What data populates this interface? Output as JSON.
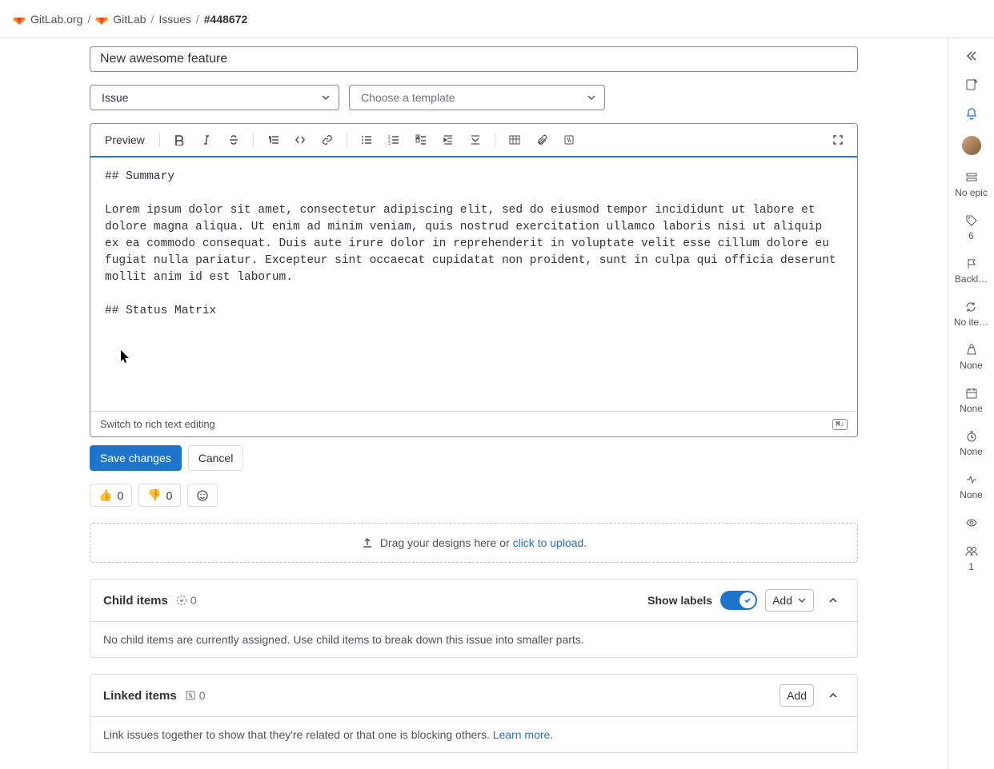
{
  "breadcrumb": {
    "org": "GitLab.org",
    "project": "GitLab",
    "section": "Issues",
    "id": "#448672"
  },
  "title_input": {
    "value": "New awesome feature"
  },
  "type_select": {
    "value": "Issue"
  },
  "template_select": {
    "placeholder": "Choose a template"
  },
  "editor": {
    "preview": "Preview",
    "content": "## Summary\n\nLorem ipsum dolor sit amet, consectetur adipiscing elit, sed do eiusmod tempor incididunt ut labore et dolore magna aliqua. Ut enim ad minim veniam, quis nostrud exercitation ullamco laboris nisi ut aliquip ex ea commodo consequat. Duis aute irure dolor in reprehenderit in voluptate velit esse cillum dolore eu fugiat nulla pariatur. Excepteur sint occaecat cupidatat non proident, sunt in culpa qui officia deserunt mollit anim id est laborum.\n\n## Status Matrix\n\n\n\n",
    "switch_text": "Switch to rich text editing",
    "md_badge": "M↓"
  },
  "actions": {
    "save": "Save changes",
    "cancel": "Cancel"
  },
  "reactions": {
    "up_emoji": "👍",
    "up_count": "0",
    "down_emoji": "👎",
    "down_count": "0"
  },
  "upload": {
    "text": "Drag your designs here or ",
    "link": "click to upload",
    "suffix": "."
  },
  "child_items": {
    "title": "Child items",
    "count": "0",
    "show_labels": "Show labels",
    "add": "Add",
    "body": "No child items are currently assigned. Use child items to break down this issue into smaller parts."
  },
  "linked_items": {
    "title": "Linked items",
    "count": "0",
    "add": "Add",
    "body_prefix": "Link issues together to show that they're related or that one is blocking others. ",
    "learn_more": "Learn more."
  },
  "sidebar": {
    "no_epic": "No epic",
    "labels_count": "6",
    "backlog": "Backl…",
    "iteration": "No ite…",
    "weight": "None",
    "due": "None",
    "time": "None",
    "health": "None",
    "participants": "1"
  }
}
